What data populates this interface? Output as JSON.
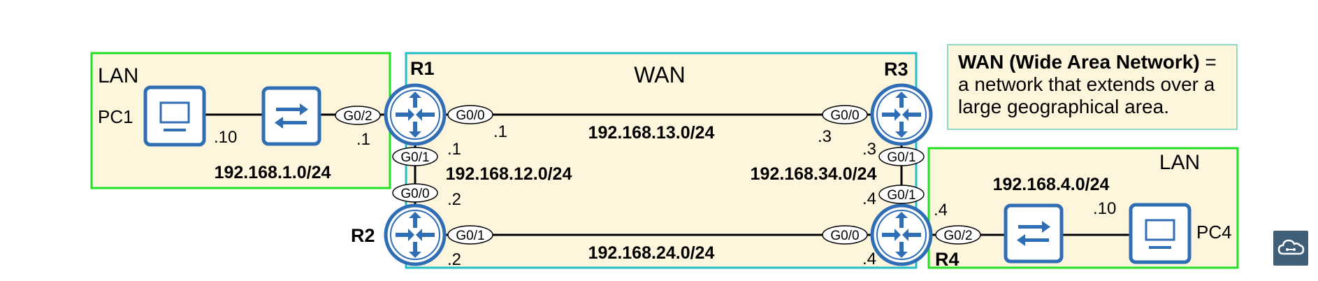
{
  "lan_left": {
    "label": "LAN",
    "subnet": "192.168.1.0/24",
    "pc": {
      "name": "PC1",
      "ip": ".10",
      "icon": "computer-icon"
    },
    "switch": {
      "icon": "switch-icon"
    },
    "r1_interface": "G0/2",
    "r1_ip": ".1"
  },
  "wan": {
    "label": "WAN",
    "links": {
      "r1_r3": {
        "subnet": "192.168.13.0/24",
        "a_if": "G0/0",
        "a_ip": ".1",
        "b_if": "G0/0",
        "b_ip": ".3"
      },
      "r1_r2": {
        "subnet": "192.168.12.0/24",
        "a_if": "G0/1",
        "a_ip": ".1",
        "b_if": "G0/0",
        "b_ip": ".2"
      },
      "r3_r4": {
        "subnet": "192.168.34.0/24",
        "a_if": "G0/1",
        "a_ip": ".3",
        "b_if": "G0/1",
        "b_ip": ".4"
      },
      "r2_r4": {
        "subnet": "192.168.24.0/24",
        "a_if": "G0/1",
        "a_ip": ".2",
        "b_if": "G0/0",
        "b_ip": ".4"
      }
    }
  },
  "routers": {
    "r1": "R1",
    "r2": "R2",
    "r3": "R3",
    "r4": "R4",
    "icon": "router-icon"
  },
  "lan_right": {
    "label": "LAN",
    "subnet": "192.168.4.0/24",
    "pc": {
      "name": "PC4",
      "ip": ".10",
      "icon": "computer-icon"
    },
    "switch": {
      "icon": "switch-icon"
    },
    "r4_interface": "G0/2",
    "r4_ip": ".4"
  },
  "definition": {
    "term": "WAN (Wide Area Network)",
    "text": " = a network that extends over a large geographical area."
  },
  "colors": {
    "lan_border": "#22e022",
    "wan_border": "#1fc0c8",
    "zone_fill": "#fdf5dc",
    "device_blue": "#2f6db5",
    "logo_bg": "#3f5f78"
  }
}
